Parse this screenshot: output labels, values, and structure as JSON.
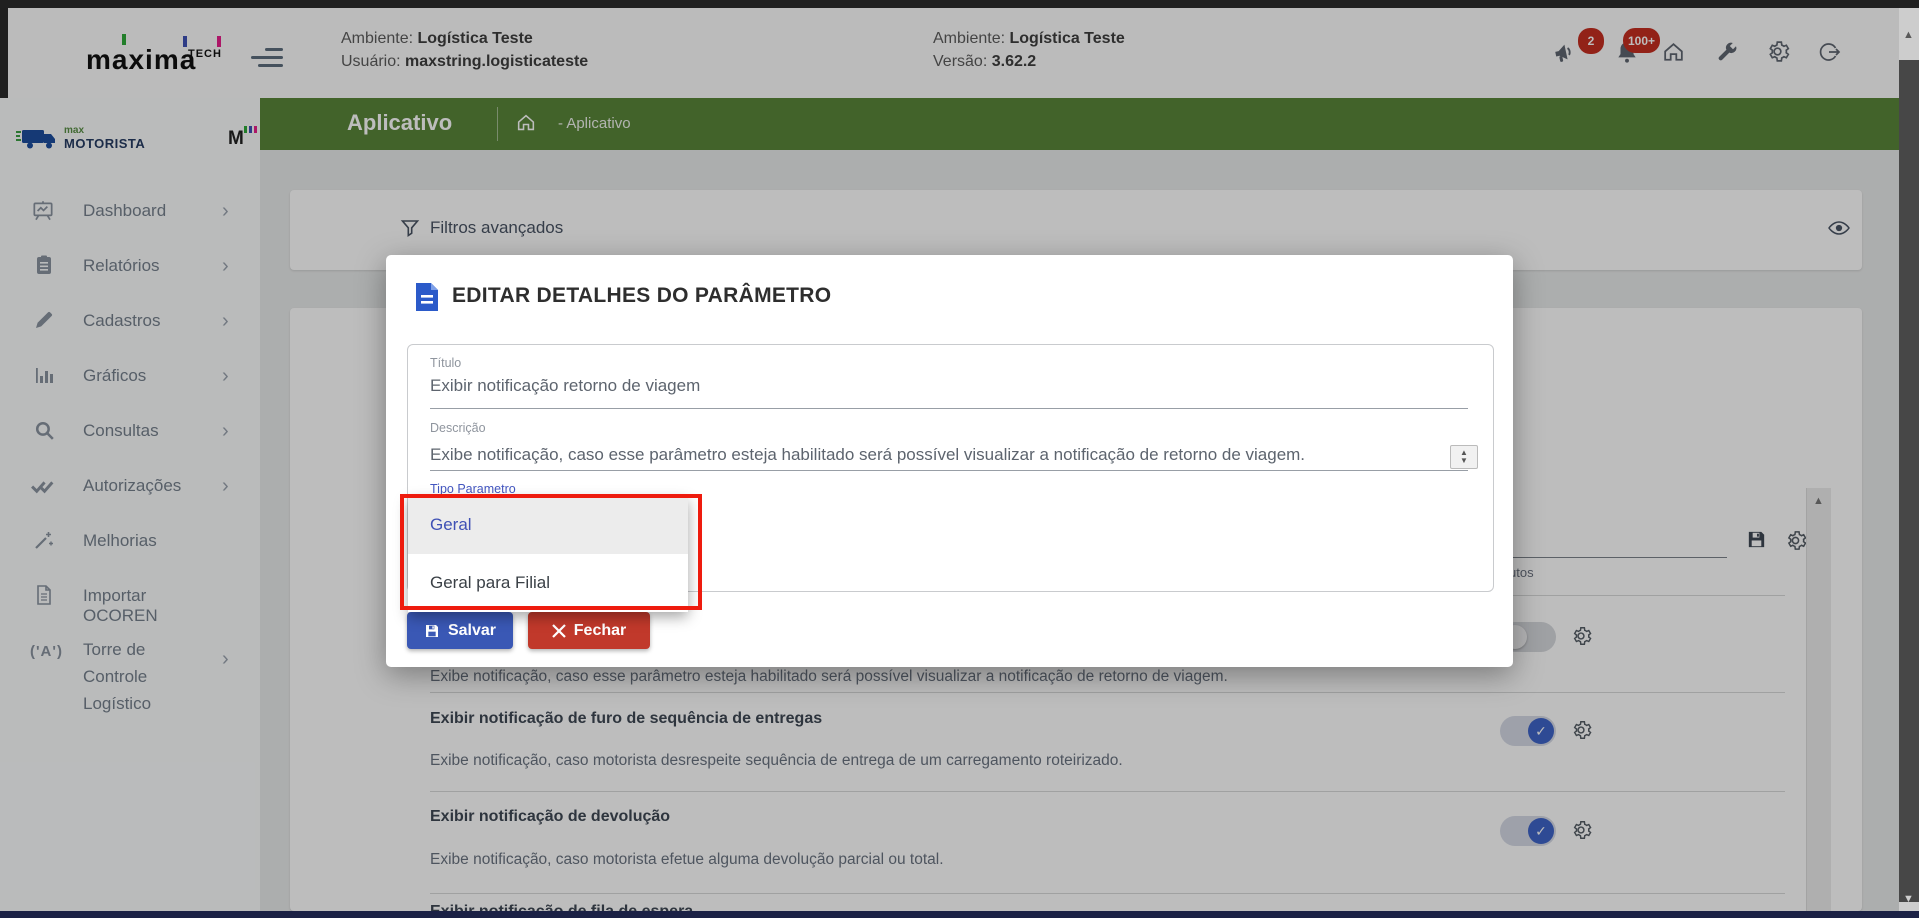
{
  "header": {
    "brand": "maxima",
    "brand_suffix": "TECH",
    "env_primary": {
      "ambiente_label": "Ambiente:",
      "ambiente_value": "Logística Teste",
      "usuario_label": "Usuário:",
      "usuario_value": "maxstring.logisticateste"
    },
    "env_secondary": {
      "ambiente_label": "Ambiente:",
      "ambiente_value": "Logística Teste",
      "versao_label": "Versão:",
      "versao_value": "3.62.2"
    },
    "badges": {
      "announcements": "2",
      "notifications": "100+"
    }
  },
  "breadcrumb": {
    "title": "Aplicativo",
    "path": "- Aplicativo"
  },
  "sidebar": {
    "logo_top": "max",
    "logo_bottom": "MOTORISTA",
    "logo_mark": "M",
    "items": [
      {
        "label": "Dashboard",
        "has_submenu": true
      },
      {
        "label": "Relatórios",
        "has_submenu": true
      },
      {
        "label": "Cadastros",
        "has_submenu": true
      },
      {
        "label": "Gráficos",
        "has_submenu": true
      },
      {
        "label": "Consultas",
        "has_submenu": true
      },
      {
        "label": "Autorizações",
        "has_submenu": true
      },
      {
        "label": "Melhorias",
        "has_submenu": false
      },
      {
        "label": "Importar OCOREN",
        "has_submenu": false
      },
      {
        "label": "Torre de Controle Logístico",
        "has_submenu": true
      }
    ]
  },
  "filters": {
    "title": "Filtros avançados"
  },
  "params_panel": {
    "header_fragment": "utos",
    "rows": [
      {
        "description": "Exibe notificação, caso esse parâmetro esteja habilitado será possível visualizar a notificação de retorno de viagem.",
        "enabled": false
      },
      {
        "title": "Exibir notificação de furo de sequência de entregas",
        "description": "Exibe notificação, caso motorista desrespeite sequência de entrega de um carregamento roteirizado.",
        "enabled": true
      },
      {
        "title": "Exibir notificação de devolução",
        "description": "Exibe notificação, caso motorista efetue alguma devolução parcial ou total.",
        "enabled": true
      },
      {
        "title": "Exibir notificação de fila de espera"
      }
    ]
  },
  "modal": {
    "title": "EDITAR DETALHES DO PARÂMETRO",
    "titulo_label": "Título",
    "titulo_value": "Exibir notificação retorno de viagem",
    "descricao_label": "Descrição",
    "descricao_value": "Exibe notificação, caso esse parâmetro esteja habilitado será possível visualizar a notificação de retorno de viagem.",
    "tipo_label": "Tipo Parametro",
    "dropdown_options": [
      {
        "label": "Geral",
        "selected": true
      },
      {
        "label": "Geral para Filial",
        "selected": false
      }
    ],
    "save_label": "Salvar",
    "close_label": "Fechar"
  },
  "colors": {
    "green_bar": "#598639",
    "toggle_on": "#3f64c8",
    "badge_red": "#c62f21",
    "save_blue": "#3a58b5",
    "close_red": "#c1392b",
    "annotation_red": "#ee1b0e",
    "dropdown_selected_text": "#3f51b5"
  }
}
